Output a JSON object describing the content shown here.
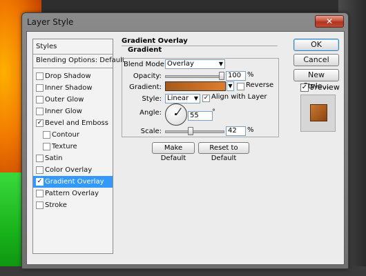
{
  "window": {
    "title": "Layer Style",
    "close_symbol": "✕"
  },
  "styles_list": {
    "header": "Styles",
    "blending_options": "Blending Options: Default",
    "items": [
      {
        "label": "Drop Shadow",
        "checked": false,
        "check": ""
      },
      {
        "label": "Inner Shadow",
        "checked": false,
        "check": ""
      },
      {
        "label": "Outer Glow",
        "checked": false,
        "check": ""
      },
      {
        "label": "Inner Glow",
        "checked": false,
        "check": ""
      },
      {
        "label": "Bevel and Emboss",
        "checked": true,
        "check": "✓"
      },
      {
        "label": "Contour",
        "checked": false,
        "check": ""
      },
      {
        "label": "Texture",
        "checked": false,
        "check": ""
      },
      {
        "label": "Satin",
        "checked": false,
        "check": ""
      },
      {
        "label": "Color Overlay",
        "checked": false,
        "check": ""
      },
      {
        "label": "Gradient Overlay",
        "checked": true,
        "check": "✓",
        "selected": true
      },
      {
        "label": "Pattern Overlay",
        "checked": false,
        "check": ""
      },
      {
        "label": "Stroke",
        "checked": false,
        "check": ""
      }
    ]
  },
  "gradient_overlay": {
    "section_title": "Gradient Overlay",
    "group_title": "Gradient",
    "blend_mode": {
      "label": "Blend Mode:",
      "value": "Overlay"
    },
    "opacity": {
      "label": "Opacity:",
      "value": "100",
      "unit": "%",
      "level": 1.0
    },
    "gradient": {
      "label": "Gradient:",
      "colors": [
        "#a65a1a",
        "#e07d2e"
      ]
    },
    "reverse": {
      "label": "Reverse",
      "checked": false,
      "check": ""
    },
    "style": {
      "label": "Style:",
      "value": "Linear"
    },
    "align_with_layer": {
      "label": "Align with Layer",
      "checked": true,
      "check": "✓"
    },
    "angle": {
      "label": "Angle:",
      "value": "55",
      "unit": "°"
    },
    "scale": {
      "label": "Scale:",
      "value": "42",
      "unit": "%",
      "level": 0.42
    },
    "make_default": "Make Default",
    "reset_to_default": "Reset to Default"
  },
  "buttons": {
    "ok": "OK",
    "cancel": "Cancel",
    "new_style": "New Style..."
  },
  "preview": {
    "label": "Preview",
    "checked": true,
    "check": "✓",
    "swatch_colors": [
      "#c87a32",
      "#8c4410"
    ]
  }
}
